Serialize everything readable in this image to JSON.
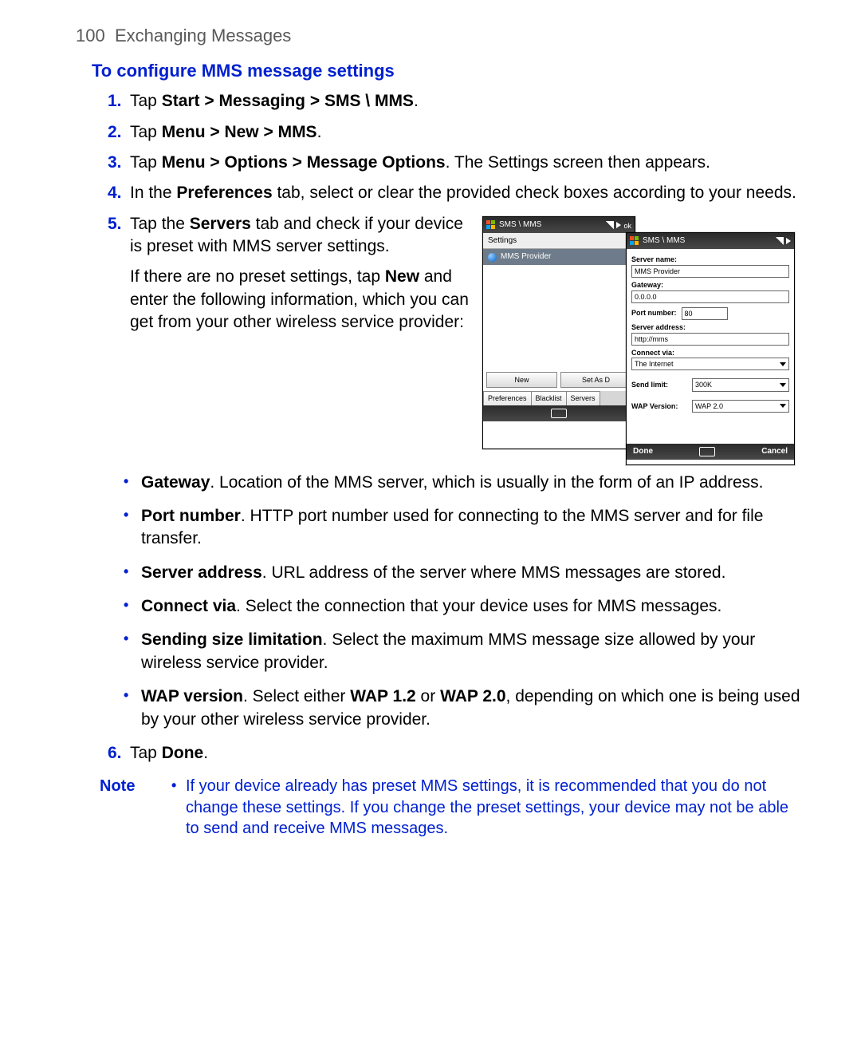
{
  "header": {
    "page_num": "100",
    "chapter": "Exchanging Messages"
  },
  "section_title": "To configure MMS message settings",
  "steps": {
    "1": {
      "num": "1.",
      "pre": "Tap ",
      "b": "Start > Messaging > SMS \\ MMS",
      "post": "."
    },
    "2": {
      "num": "2.",
      "pre": "Tap ",
      "b": "Menu > New > MMS",
      "post": "."
    },
    "3": {
      "num": "3.",
      "pre": "Tap ",
      "b": "Menu > Options > Message Options",
      "post": ". The Settings screen then appears."
    },
    "4": {
      "num": "4.",
      "pre": "In the ",
      "b": "Preferences",
      "post": " tab, select or clear the provided check boxes according to your needs."
    },
    "5": {
      "num": "5.",
      "a_pre": "Tap the ",
      "a_b": "Servers",
      "a_post": " tab and check if your device is preset with MMS server settings.",
      "b_pre": "If there are no preset settings, tap ",
      "b_b": "New",
      "b_post": " and enter the following information, which you can get from your other wireless service provider:"
    },
    "6": {
      "num": "6.",
      "pre": "Tap ",
      "b": "Done",
      "post": "."
    }
  },
  "bullets": {
    "gateway": {
      "b": "Gateway",
      "post": ". Location of the MMS server, which is usually in the form of an IP address."
    },
    "port": {
      "b": "Port number",
      "post": ". HTTP port number used for connecting to the MMS server and for file transfer."
    },
    "server": {
      "b": "Server address",
      "post": ". URL address of the server where MMS messages are stored."
    },
    "connect": {
      "b": "Connect via",
      "post": ". Select the connection that your device uses for MMS messages."
    },
    "send": {
      "b": "Sending size limitation",
      "post": ". Select the maximum MMS message size allowed by your wireless service provider."
    },
    "wap": {
      "b": "WAP version",
      "pre": ". Select either ",
      "b2": "WAP 1.2",
      "mid": " or ",
      "b3": "WAP 2.0",
      "post": ", depending on which one is being used by your other wireless service provider."
    }
  },
  "note": {
    "label": "Note",
    "bullet": "•",
    "text": "If your device already has preset MMS settings, it is recommended that you do not change these settings. If you change the preset settings, your device may not be able to send and receive MMS messages."
  },
  "shot1": {
    "title": "SMS \\ MMS",
    "sub": "Settings",
    "item": "MMS Provider",
    "btn_new": "New",
    "btn_default": "Set As D",
    "tab1": "Preferences",
    "tab2": "Blacklist",
    "tab3": "Servers"
  },
  "shot2": {
    "title": "SMS \\ MMS",
    "l_server": "Server name:",
    "v_server": "MMS Provider",
    "l_gateway": "Gateway:",
    "v_gateway": "0.0.0.0",
    "l_port": "Port number:",
    "v_port": "80",
    "l_addr": "Server address:",
    "v_addr": "http://mms",
    "l_conn": "Connect via:",
    "v_conn": "The Internet",
    "l_send": "Send limit:",
    "v_send": "300K",
    "l_wap": "WAP Version:",
    "v_wap": "WAP 2.0",
    "done": "Done",
    "cancel": "Cancel"
  }
}
